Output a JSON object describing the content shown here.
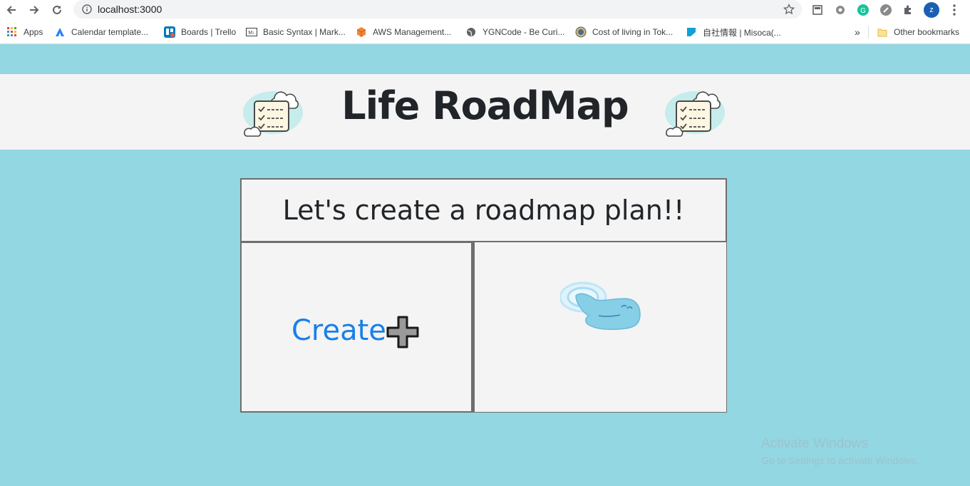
{
  "browser": {
    "url": "localhost:3000",
    "avatar_letter": "z",
    "bookmarks": [
      {
        "label": "Apps",
        "icon": "apps-grid-icon"
      },
      {
        "label": "Calendar template...",
        "icon": "atlassian-icon"
      },
      {
        "label": "Boards | Trello",
        "icon": "trello-icon"
      },
      {
        "label": "Basic Syntax | Mark...",
        "icon": "markdown-icon"
      },
      {
        "label": "AWS Management...",
        "icon": "aws-cube-icon"
      },
      {
        "label": "YGNCode - Be Curi...",
        "icon": "globe-icon"
      },
      {
        "label": "Cost of living in Tok...",
        "icon": "site-seal-icon"
      },
      {
        "label": "自社情報 | Misoca(...",
        "icon": "misoca-icon"
      }
    ],
    "other_bookmarks": "Other bookmarks",
    "overflow": "»"
  },
  "page": {
    "title": "Life RoadMap",
    "prompt": "Let's create a roadmap plan!!",
    "create_label": "Create",
    "icons": {
      "logo": "checklist-clouds-icon",
      "create": "plus-icon",
      "pointer": "tapping-hand-icon"
    }
  },
  "watermark": {
    "title": "Activate Windows",
    "subtitle": "Go to Settings to activate Windows."
  },
  "colors": {
    "page_bg": "#93d7e3",
    "panel_bg": "#f4f4f4",
    "link": "#1a7fe6",
    "text": "#212529"
  }
}
